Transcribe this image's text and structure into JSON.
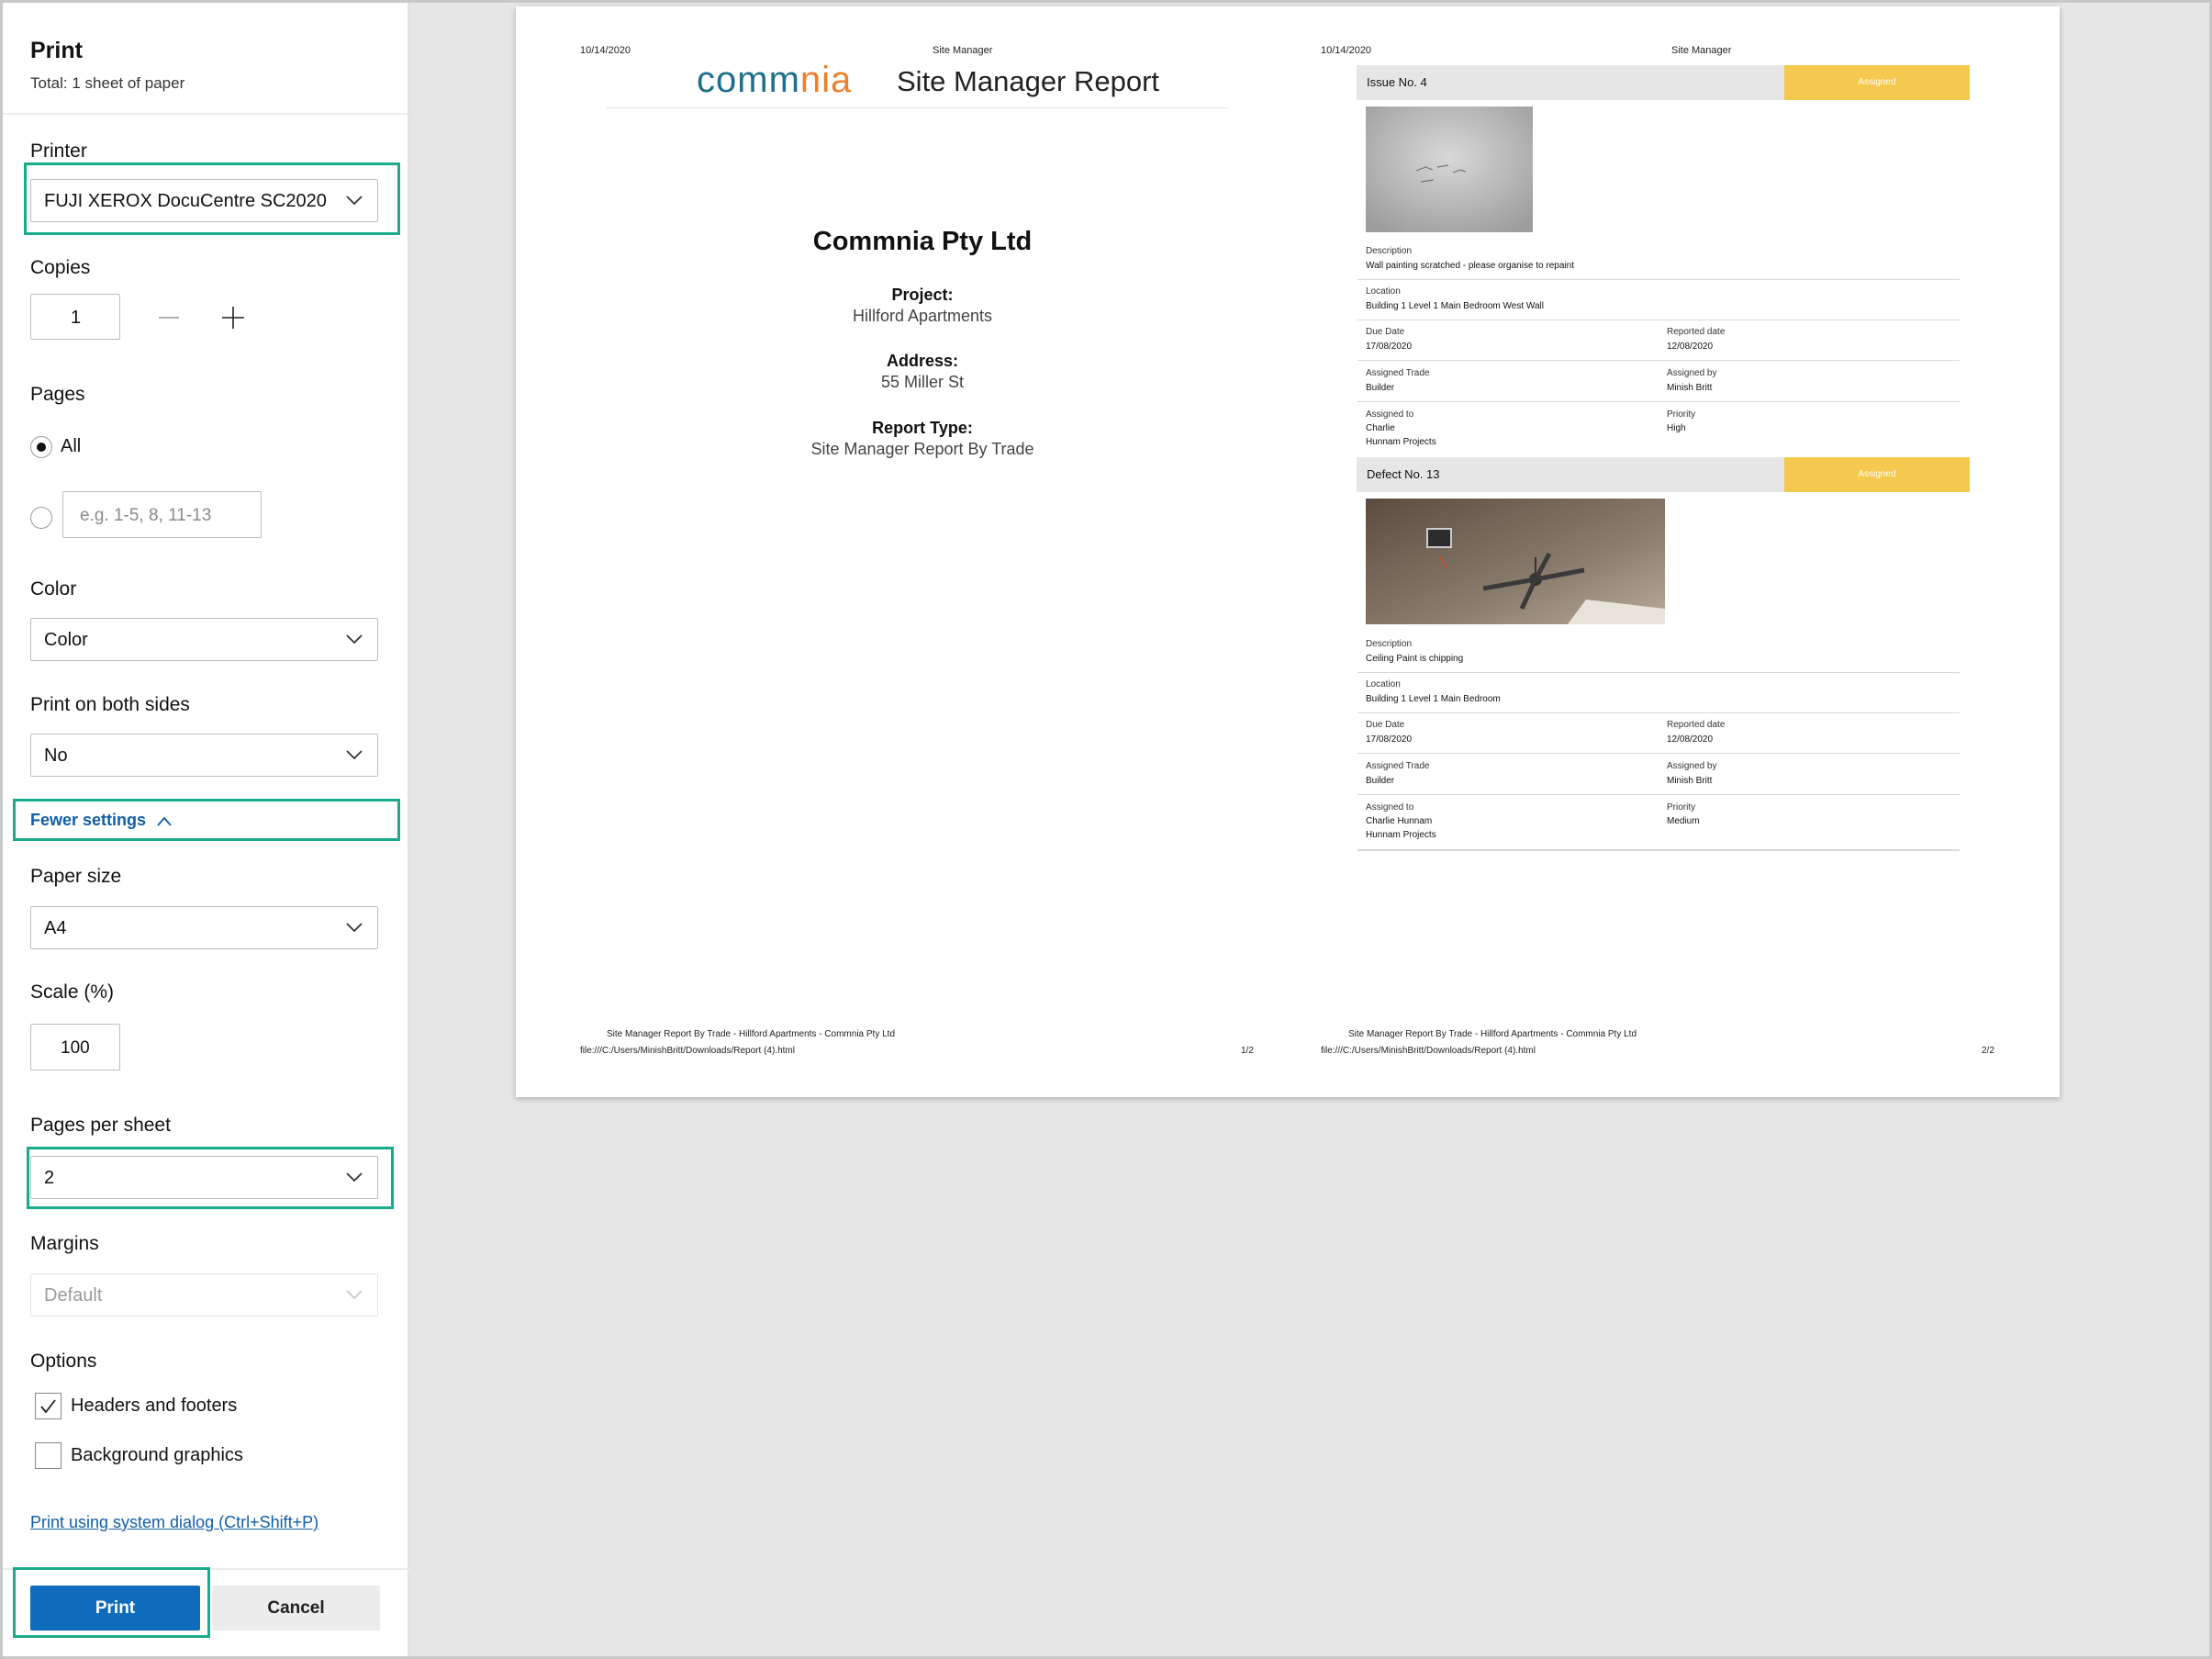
{
  "dialog": {
    "title": "Print",
    "total": "Total: 1 sheet of paper",
    "printer": {
      "label": "Printer",
      "value": "FUJI XEROX DocuCentre SC2020"
    },
    "copies": {
      "label": "Copies",
      "value": "1"
    },
    "pages": {
      "label": "Pages",
      "all_label": "All",
      "range_placeholder": "e.g. 1-5, 8, 11-13"
    },
    "color": {
      "label": "Color",
      "value": "Color"
    },
    "duplex": {
      "label": "Print on both sides",
      "value": "No"
    },
    "fewer_settings": "Fewer settings",
    "paper_size": {
      "label": "Paper size",
      "value": "A4"
    },
    "scale": {
      "label": "Scale (%)",
      "value": "100"
    },
    "pages_per_sheet": {
      "label": "Pages per sheet",
      "value": "2"
    },
    "margins": {
      "label": "Margins",
      "value": "Default"
    },
    "options": {
      "label": "Options",
      "headers_footers": "Headers and footers",
      "headers_footers_checked": true,
      "background_graphics": "Background graphics",
      "background_graphics_checked": false
    },
    "system_dialog_link": "Print using system dialog (Ctrl+Shift+P)",
    "print_button": "Print",
    "cancel_button": "Cancel",
    "accent_color": "#0f6cbd",
    "highlight_color": "#1aab8b"
  },
  "preview": {
    "page1": {
      "date": "10/14/2020",
      "header_title": "Site Manager",
      "logo_text": "commnia",
      "report_title": "Site Manager Report",
      "company": "Commnia Pty Ltd",
      "project_label": "Project:",
      "project_value": "Hillford Apartments",
      "address_label": "Address:",
      "address_value": "55 Miller St",
      "report_type_label": "Report Type:",
      "report_type_value": "Site Manager Report By Trade",
      "footer_title": "Site Manager Report By Trade - Hillford Apartments - Commnia Pty Ltd",
      "footer_url": "file:///C:/Users/MinishBritt/Downloads/Report (4).html",
      "page_num": "1/2"
    },
    "page2": {
      "date": "10/14/2020",
      "header_title": "Site Manager",
      "issue": {
        "name": "Issue No. 4",
        "status": "Assigned",
        "description_label": "Description",
        "description": "Wall painting scratched - please organise to repaint",
        "location_label": "Location",
        "location": "Building 1 Level 1 Main Bedroom West Wall",
        "due_label": "Due Date",
        "due": "17/08/2020",
        "reported_label": "Reported date",
        "reported": "12/08/2020",
        "trade_label": "Assigned Trade",
        "trade": "Builder",
        "assigned_by_label": "Assigned by",
        "assigned_by": "Minish Britt",
        "assigned_to_label": "Assigned to",
        "assigned_to_1": "Charlie",
        "assigned_to_2": "Hunnam Projects",
        "priority_label": "Priority",
        "priority": "High"
      },
      "defect": {
        "name": "Defect No. 13",
        "status": "Assigned",
        "description_label": "Description",
        "description": "Ceiling Paint is chipping",
        "location_label": "Location",
        "location": "Building 1 Level 1 Main Bedroom",
        "due_label": "Due Date",
        "due": "17/08/2020",
        "reported_label": "Reported date",
        "reported": "12/08/2020",
        "trade_label": "Assigned Trade",
        "trade": "Builder",
        "assigned_by_label": "Assigned by",
        "assigned_by": "Minish Britt",
        "assigned_to_label": "Assigned to",
        "assigned_to_1": "Charlie Hunnam",
        "assigned_to_2": "Hunnam Projects",
        "priority_label": "Priority",
        "priority": "Medium"
      },
      "footer_title": "Site Manager Report By Trade - Hillford Apartments - Commnia Pty Ltd",
      "footer_url": "file:///C:/Users/MinishBritt/Downloads/Report (4).html",
      "page_num": "2/2"
    }
  }
}
